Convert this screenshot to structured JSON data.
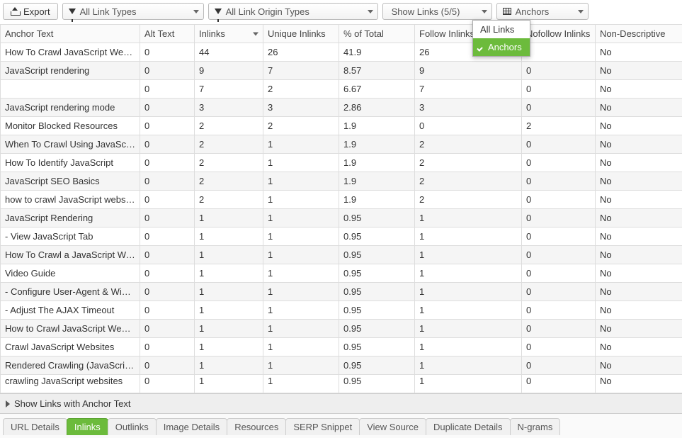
{
  "toolbar": {
    "export_label": "Export",
    "filter_link_types": "All Link Types",
    "filter_origin_types": "All Link Origin Types",
    "show_links": "Show Links (5/5)",
    "anchors": "Anchors"
  },
  "dropdown": {
    "all_links": "All Links",
    "anchors": "Anchors"
  },
  "columns": [
    "Anchor Text",
    "Alt Text",
    "Inlinks",
    "Unique Inlinks",
    "% of Total",
    "Follow Inlinks",
    "Nofollow Inlinks",
    "Non-Descriptive"
  ],
  "rows": [
    {
      "anchor": "How To Crawl JavaScript Websites",
      "alt": "0",
      "inlinks": "44",
      "unique": "26",
      "pct": "41.9",
      "follow": "26",
      "nofollow": "",
      "nd": "No"
    },
    {
      "anchor": "JavaScript rendering",
      "alt": "0",
      "inlinks": "9",
      "unique": "7",
      "pct": "8.57",
      "follow": "9",
      "nofollow": "0",
      "nd": "No"
    },
    {
      "anchor": "",
      "alt": "0",
      "inlinks": "7",
      "unique": "2",
      "pct": "6.67",
      "follow": "7",
      "nofollow": "0",
      "nd": "No"
    },
    {
      "anchor": "JavaScript rendering mode",
      "alt": "0",
      "inlinks": "3",
      "unique": "3",
      "pct": "2.86",
      "follow": "3",
      "nofollow": "0",
      "nd": "No"
    },
    {
      "anchor": "Monitor Blocked Resources",
      "alt": "0",
      "inlinks": "2",
      "unique": "2",
      "pct": "1.9",
      "follow": "0",
      "nofollow": "2",
      "nd": "No"
    },
    {
      "anchor": "When To Crawl Using JavaScript",
      "alt": "0",
      "inlinks": "2",
      "unique": "1",
      "pct": "1.9",
      "follow": "2",
      "nofollow": "0",
      "nd": "No"
    },
    {
      "anchor": "How To Identify JavaScript",
      "alt": "0",
      "inlinks": "2",
      "unique": "1",
      "pct": "1.9",
      "follow": "2",
      "nofollow": "0",
      "nd": "No"
    },
    {
      "anchor": "JavaScript SEO Basics",
      "alt": "0",
      "inlinks": "2",
      "unique": "1",
      "pct": "1.9",
      "follow": "2",
      "nofollow": "0",
      "nd": "No"
    },
    {
      "anchor": "how to crawl JavaScript websites",
      "alt": "0",
      "inlinks": "2",
      "unique": "1",
      "pct": "1.9",
      "follow": "2",
      "nofollow": "0",
      "nd": "No"
    },
    {
      "anchor": "JavaScript Rendering",
      "alt": "0",
      "inlinks": "1",
      "unique": "1",
      "pct": "0.95",
      "follow": "1",
      "nofollow": "0",
      "nd": "No"
    },
    {
      "anchor": "- View JavaScript Tab",
      "alt": "0",
      "inlinks": "1",
      "unique": "1",
      "pct": "0.95",
      "follow": "1",
      "nofollow": "0",
      "nd": "No"
    },
    {
      "anchor": "How To Crawl a JavaScript Websi...",
      "alt": "0",
      "inlinks": "1",
      "unique": "1",
      "pct": "0.95",
      "follow": "1",
      "nofollow": "0",
      "nd": "No"
    },
    {
      "anchor": "Video Guide",
      "alt": "0",
      "inlinks": "1",
      "unique": "1",
      "pct": "0.95",
      "follow": "1",
      "nofollow": "0",
      "nd": "No"
    },
    {
      "anchor": "- Configure User-Agent & Window ...",
      "alt": "0",
      "inlinks": "1",
      "unique": "1",
      "pct": "0.95",
      "follow": "1",
      "nofollow": "0",
      "nd": "No"
    },
    {
      "anchor": "- Adjust The AJAX Timeout",
      "alt": "0",
      "inlinks": "1",
      "unique": "1",
      "pct": "0.95",
      "follow": "1",
      "nofollow": "0",
      "nd": "No"
    },
    {
      "anchor": "How to Crawl JavaScript Websites",
      "alt": "0",
      "inlinks": "1",
      "unique": "1",
      "pct": "0.95",
      "follow": "1",
      "nofollow": "0",
      "nd": "No"
    },
    {
      "anchor": "Crawl JavaScript Websites",
      "alt": "0",
      "inlinks": "1",
      "unique": "1",
      "pct": "0.95",
      "follow": "1",
      "nofollow": "0",
      "nd": "No"
    },
    {
      "anchor": "Rendered Crawling (JavaScript)",
      "alt": "0",
      "inlinks": "1",
      "unique": "1",
      "pct": "0.95",
      "follow": "1",
      "nofollow": "0",
      "nd": "No"
    },
    {
      "anchor": "crawling JavaScript websites",
      "alt": "0",
      "inlinks": "1",
      "unique": "1",
      "pct": "0.95",
      "follow": "1",
      "nofollow": "0",
      "nd": "No"
    }
  ],
  "footer_toggle": "Show Links with Anchor Text",
  "tabs": [
    "URL Details",
    "Inlinks",
    "Outlinks",
    "Image Details",
    "Resources",
    "SERP Snippet",
    "View Source",
    "Duplicate Details",
    "N-grams"
  ],
  "active_tab_index": 1
}
